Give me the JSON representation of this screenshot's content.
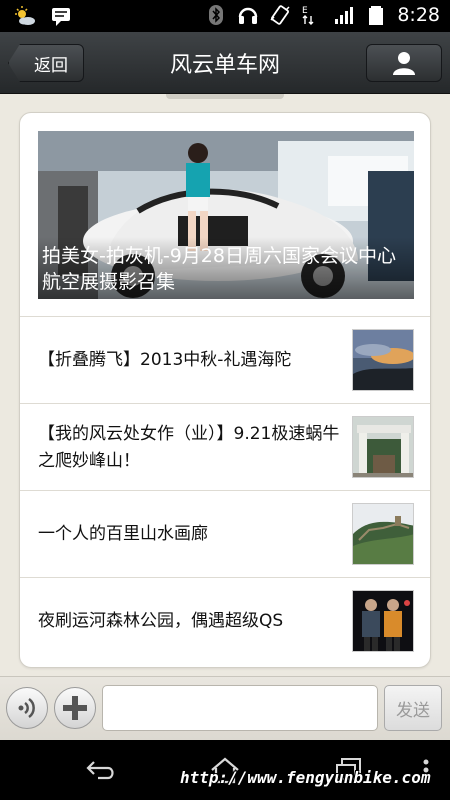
{
  "status_bar": {
    "time": "8:28",
    "left_icons": [
      "weather-icon",
      "message-icon"
    ],
    "right_icons": [
      "bluetooth-icon",
      "headset-icon",
      "vibrate-icon",
      "network-e-icon",
      "signal-icon",
      "battery-icon"
    ]
  },
  "header": {
    "back_label": "返回",
    "title": "风云单车网",
    "profile_icon": "user-icon"
  },
  "feed": {
    "hero": {
      "caption": "拍美女-拍灰机-9月28日周六国家会议中心航空展摄影召集"
    },
    "articles": [
      {
        "title": "【折叠腾飞】2013中秋-礼遇海陀"
      },
      {
        "title": "【我的风云处女作（业）】9.21极速蜗牛之爬妙峰山！"
      },
      {
        "title": "一个人的百里山水画廊"
      },
      {
        "title": "夜刷运河森林公园，偶遇超级QS"
      }
    ]
  },
  "input_bar": {
    "voice_icon": "voice-icon",
    "add_icon": "plus-icon",
    "input_value": "",
    "send_label": "发送"
  },
  "nav_bar": {
    "icons": [
      "back-icon",
      "home-icon",
      "recent-apps-icon",
      "menu-icon"
    ]
  },
  "watermark": "http://www.fengyunbike.com",
  "colors": {
    "header_bg": "#2e3133",
    "page_bg": "#ece9e0",
    "card_bg": "#ffffff",
    "send_text": "#9a9a9a"
  }
}
